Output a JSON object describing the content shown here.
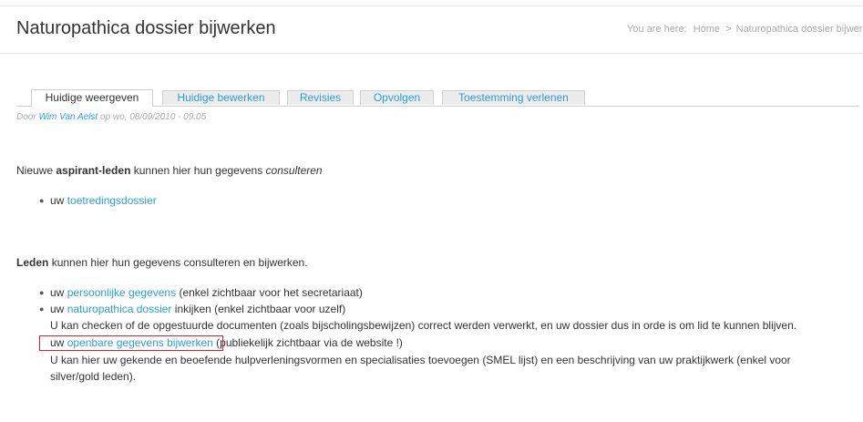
{
  "header": {
    "title": "Naturopathica dossier bijwerken",
    "breadcrumb_prefix": "You are here:",
    "breadcrumb_home": "Home",
    "breadcrumb_sep": ">",
    "breadcrumb_current": "Naturopathica dossier bijwer"
  },
  "tabs": [
    {
      "label": "Huidige weergeven",
      "active": true
    },
    {
      "label": "Huidige bewerken",
      "active": false
    },
    {
      "label": "Revisies",
      "active": false
    },
    {
      "label": "Opvolgen",
      "active": false
    },
    {
      "label": "Toestemming verlenen",
      "active": false
    }
  ],
  "submitted": {
    "prefix": "Door",
    "author": "Wim Van Aelst",
    "suffix": "op wo, 08/09/2010 - 09:05"
  },
  "section1": {
    "text_a": "Nieuwe",
    "text_bold": "aspirant-leden",
    "text_b": "kunnen hier hun gegevens",
    "text_italic": "consulteren",
    "item_prefix": "uw",
    "item_link": "toetredingsdossier"
  },
  "section2": {
    "text_bold": "Leden",
    "text_rest": "kunnen hier hun gegevens consulteren en bijwerken.",
    "items": [
      {
        "prefix": "uw",
        "link": "persoonlijke gegevens",
        "suffix": "(enkel zichtbaar voor het secretariaat)"
      },
      {
        "prefix": "uw",
        "link": "naturopathica dossier",
        "suffix": "inkijken (enkel zichtbaar voor uzelf)"
      }
    ],
    "note1": "U kan checken of de opgestuurde documenten (zoals bijscholingsbewijzen) correct werden verwerkt, en uw dossier dus in orde is om lid te kunnen blijven.",
    "public_prefix": "uw",
    "public_link": "openbare gegevens bijwerken",
    "public_suffix": "(publiekelijk zichtbaar via de website !)",
    "note2": "U kan hier uw gekende en beoefende hulpverleningsvormen en specialisaties toevoegen (SMEL lijst) en een beschrijving van uw praktijkwerk (enkel voor silver/gold leden)."
  },
  "colors": {
    "link": "#2a9fd6",
    "highlight": "#e02020"
  }
}
